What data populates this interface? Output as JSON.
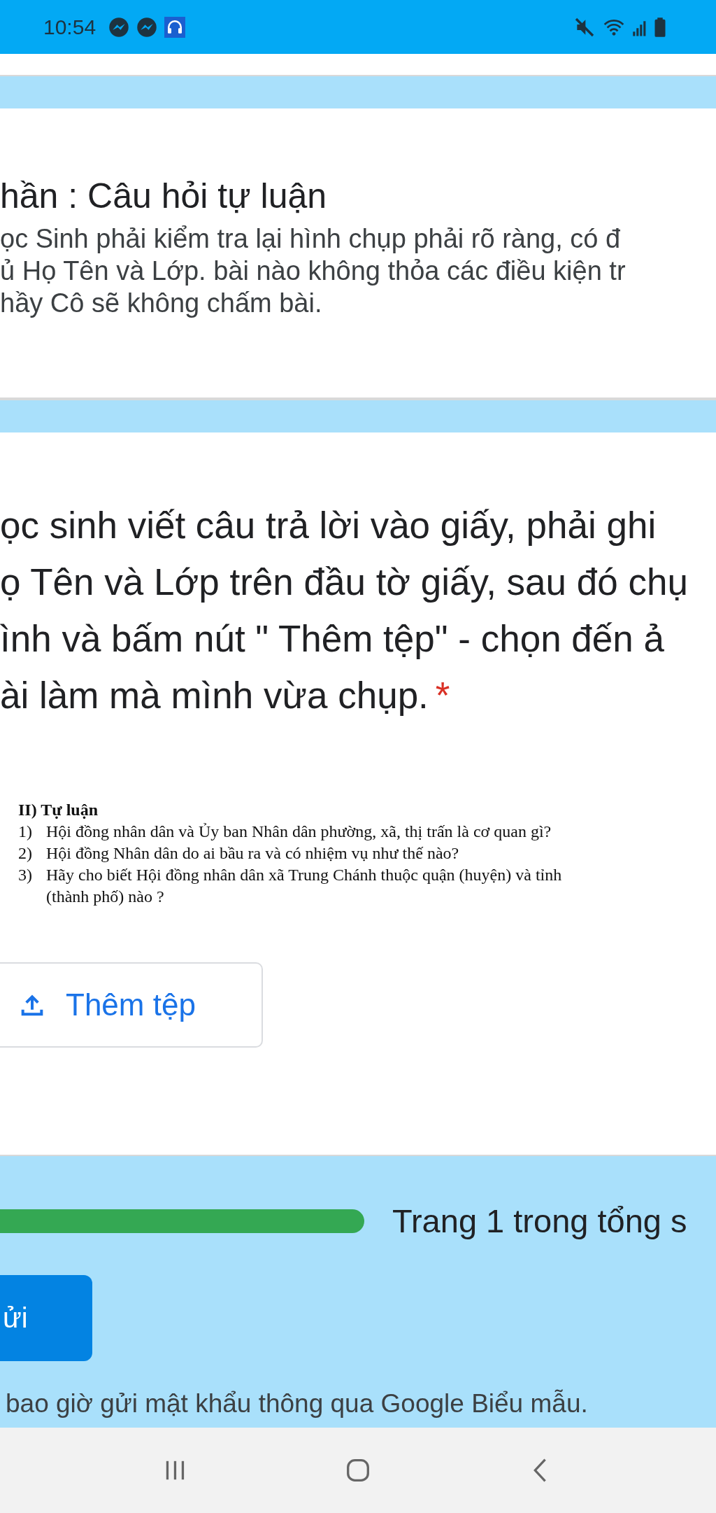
{
  "status_bar": {
    "time": "10:54"
  },
  "section": {
    "title": "hần : Câu hỏi tự luận",
    "description_lines": [
      "ọc Sinh phải kiểm tra lại hình chụp phải rõ ràng, có đ",
      "ủ Họ Tên và Lớp. bài nào không thỏa các điều kiện tr",
      "hầy Cô sẽ không chấm bài."
    ]
  },
  "question": {
    "title_lines": [
      "ọc sinh viết câu trả lời vào giấy, phải ghi",
      "ọ Tên và Lớp trên đầu tờ giấy, sau đó chụ",
      "ình và bấm nút \" Thêm tệp\" - chọn đến ả",
      "ài làm mà mình vừa chụp."
    ],
    "required_mark": "*",
    "attachment": {
      "heading": "II) Tự luận",
      "items": [
        {
          "number": "1)",
          "lines": [
            "Hội đồng nhân dân và Ủy ban Nhân dân phường, xã, thị trấn là cơ quan gì?"
          ]
        },
        {
          "number": "2)",
          "lines": [
            "Hội đồng Nhân dân do ai bầu ra và có nhiệm vụ như thế nào?"
          ]
        },
        {
          "number": "3)",
          "lines": [
            "Hãy cho biết Hội đồng nhân dân xã Trung Chánh thuộc quận (huyện) và tỉnh",
            "(thành phố) nào ?"
          ]
        }
      ]
    },
    "upload_button": "Thêm tệp"
  },
  "footer": {
    "page_text": "Trang 1 trong tổng s",
    "submit_button": "ửi",
    "notice": "bao giờ gửi mật khẩu thông qua Google Biểu mẫu."
  }
}
